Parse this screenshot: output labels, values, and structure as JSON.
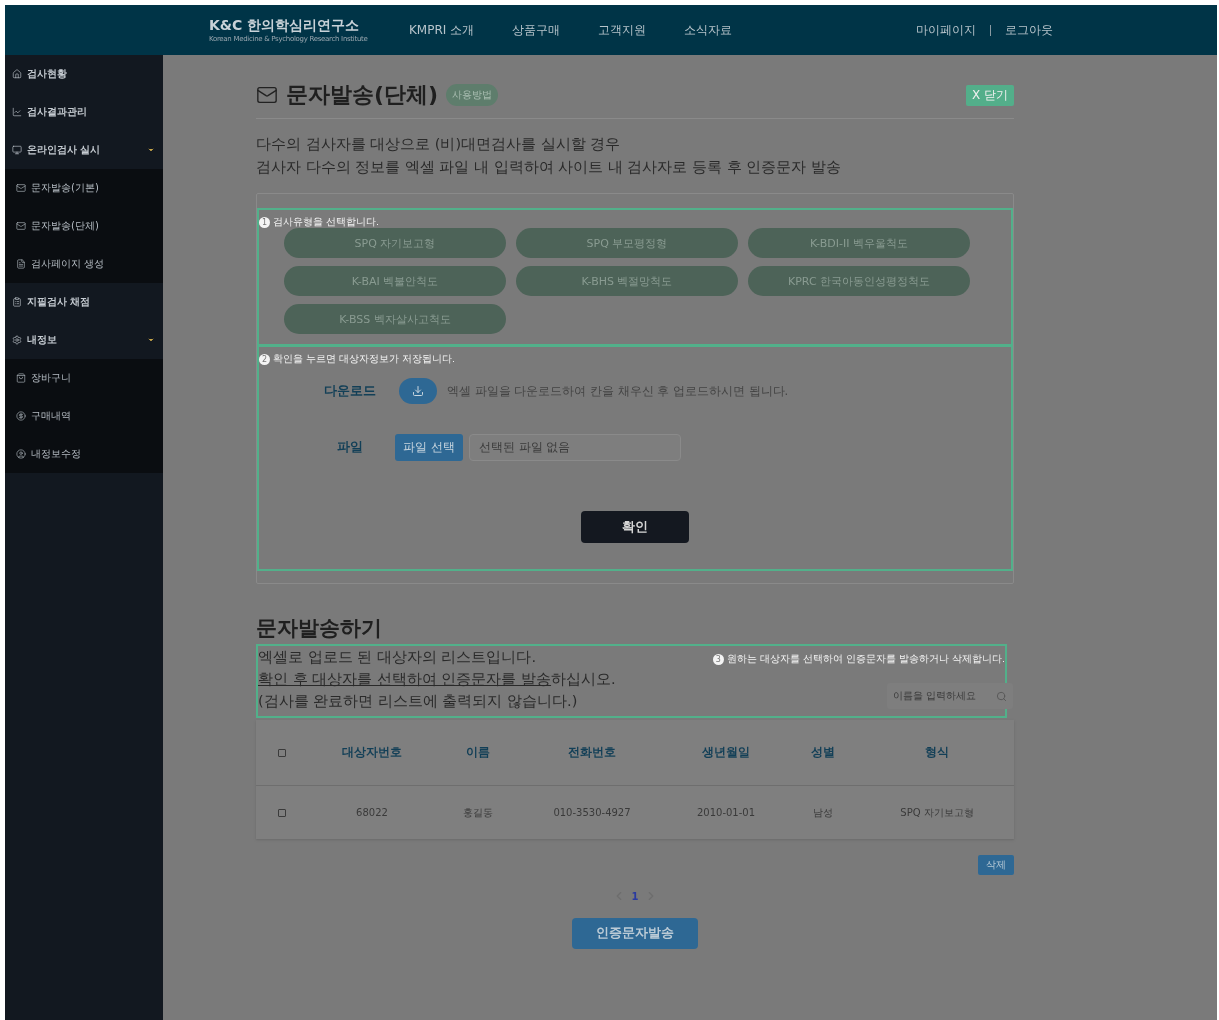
{
  "header": {
    "logo_main": "K&C 한의학심리연구소",
    "logo_sub": "Korean Medicine & Psychology Research Institute",
    "nav": [
      "KMPRI 소개",
      "상품구매",
      "고객지원",
      "소식자료"
    ],
    "user_links": [
      "마이페이지",
      "로그아웃"
    ]
  },
  "sidebar": {
    "items": [
      {
        "label": "검사현황"
      },
      {
        "label": "검사결과관리"
      },
      {
        "label": "온라인검사 실시",
        "expanded": true,
        "children": [
          {
            "label": "문자발송(기본)"
          },
          {
            "label": "문자발송(단체)"
          },
          {
            "label": "검사페이지 생성"
          }
        ]
      },
      {
        "label": "지필검사 채점"
      },
      {
        "label": "내정보",
        "expanded": true,
        "children": [
          {
            "label": "장바구니"
          },
          {
            "label": "구매내역"
          },
          {
            "label": "내정보수정"
          }
        ]
      }
    ]
  },
  "page": {
    "title": "문자발송(단체)",
    "help_badge": "사용방법",
    "close_button": "X 닫기",
    "intro": [
      "다수의 검사자를 대상으로 (비)대면검사를 실시할 경우",
      "검사자 다수의 정보를 엑셀 파일 내 입력하여 사이트 내 검사자로 등록 후 인증문자 발송"
    ]
  },
  "step1": {
    "number": "1",
    "hint": "검사유형을 선택합니다.",
    "test_types": [
      "SPQ 자기보고형",
      "SPQ 부모평정형",
      "K-BDI-II 벡우울척도",
      "K-BAI 벡불안척도",
      "K-BHS 벡절망척도",
      "KPRC 한국아동인성평정척도",
      "K-BSS 벡자살사고척도"
    ]
  },
  "step2": {
    "number": "2",
    "hint": "확인을 누르면 대상자정보가 저장됩니다.",
    "download_label": "다운로드",
    "download_hint": "엑셀 파일을 다운로드하여 칸을 채우신 후 업로드하시면 됩니다.",
    "file_label": "파일",
    "file_button": "파일 선택",
    "file_value": "선택된 파일 없음",
    "confirm_button": "확인"
  },
  "send": {
    "title": "문자발송하기",
    "lines": [
      {
        "rest": "엑셀로 업로드 된 대상자의 리스트입니다."
      },
      {
        "underlined": "확인 후 대상자를 선택하여 인증문자를 발송",
        "rest": "하십시오."
      },
      {
        "rest": "(검사를 완료하면 리스트에 출력되지 않습니다.)"
      }
    ],
    "step_number": "3",
    "step_hint": "원하는 대상자를 선택하여 인증문자를 발송하거나 삭제합니다.",
    "search": {
      "placeholder": "이름을 입력하세요"
    }
  },
  "table": {
    "select_all_checked": false,
    "columns": [
      "대상자번호",
      "이름",
      "전화번호",
      "생년월일",
      "성별",
      "형식"
    ],
    "rows": [
      {
        "checked": false,
        "cells": [
          "68022",
          "홍길동",
          "010-3530-4927",
          "2010-01-01",
          "남성",
          "SPQ 자기보고형"
        ]
      }
    ]
  },
  "delete_button": "삭제",
  "pagination": {
    "pages": [
      {
        "label": "1",
        "selected": true
      }
    ]
  },
  "send_button": "인증문자발송"
}
